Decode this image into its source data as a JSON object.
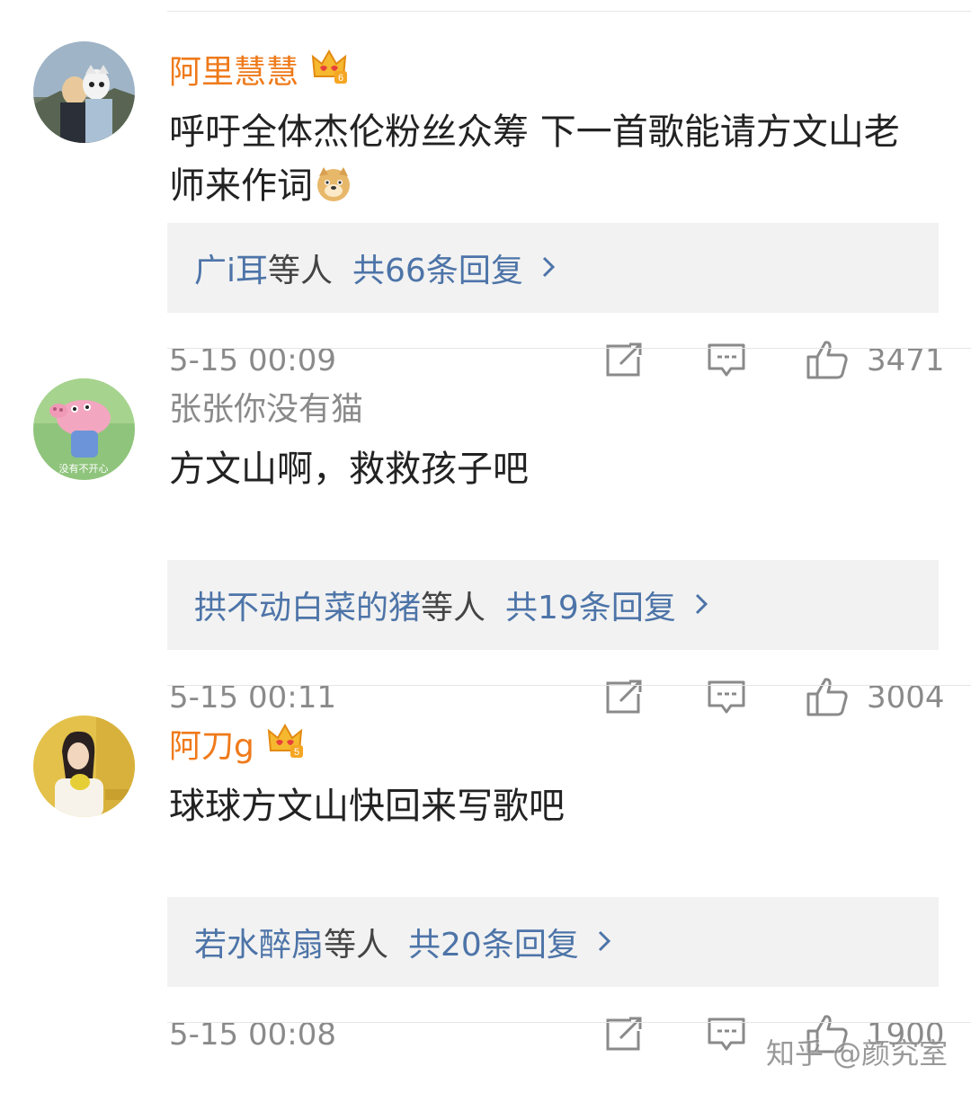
{
  "comments": [
    {
      "username": "阿里慧慧",
      "vip": true,
      "vip_level": "6",
      "text": "呼吁全体杰伦粉丝众筹 下一首歌能请方文山老师来作词",
      "has_emoji": true,
      "emoji": "doge-emoji",
      "replies_who": "广i耳",
      "replies_etc": "等人",
      "replies_count": "共66条回复",
      "time": "5-15 00:09",
      "likes": "3471"
    },
    {
      "username": "张张你没有猫",
      "vip": false,
      "avatar_caption": "没有不开心",
      "text": "方文山啊，救救孩子吧",
      "has_emoji": false,
      "replies_who": "拱不动白菜的猪",
      "replies_etc": "等人",
      "replies_count": "共19条回复",
      "time": "5-15 00:11",
      "likes": "3004"
    },
    {
      "username": "阿刀g",
      "vip": true,
      "vip_level": "5",
      "text": "球球方文山快回来写歌吧",
      "has_emoji": false,
      "replies_who": "若水醉扇",
      "replies_etc": "等人",
      "replies_count": "共20条回复",
      "time": "5-15 00:08",
      "likes": "1900"
    }
  ],
  "icons": [
    "crown-vip-icon",
    "chevron-right-icon",
    "share-icon",
    "reply-icon",
    "like-icon"
  ],
  "colors": {
    "vip_name": "#ef7a1a",
    "link_blue": "#4d74a8",
    "meta_gray": "#8a8a8a",
    "reply_box_bg": "#f2f2f2"
  },
  "watermark": "知乎 @颜究室"
}
